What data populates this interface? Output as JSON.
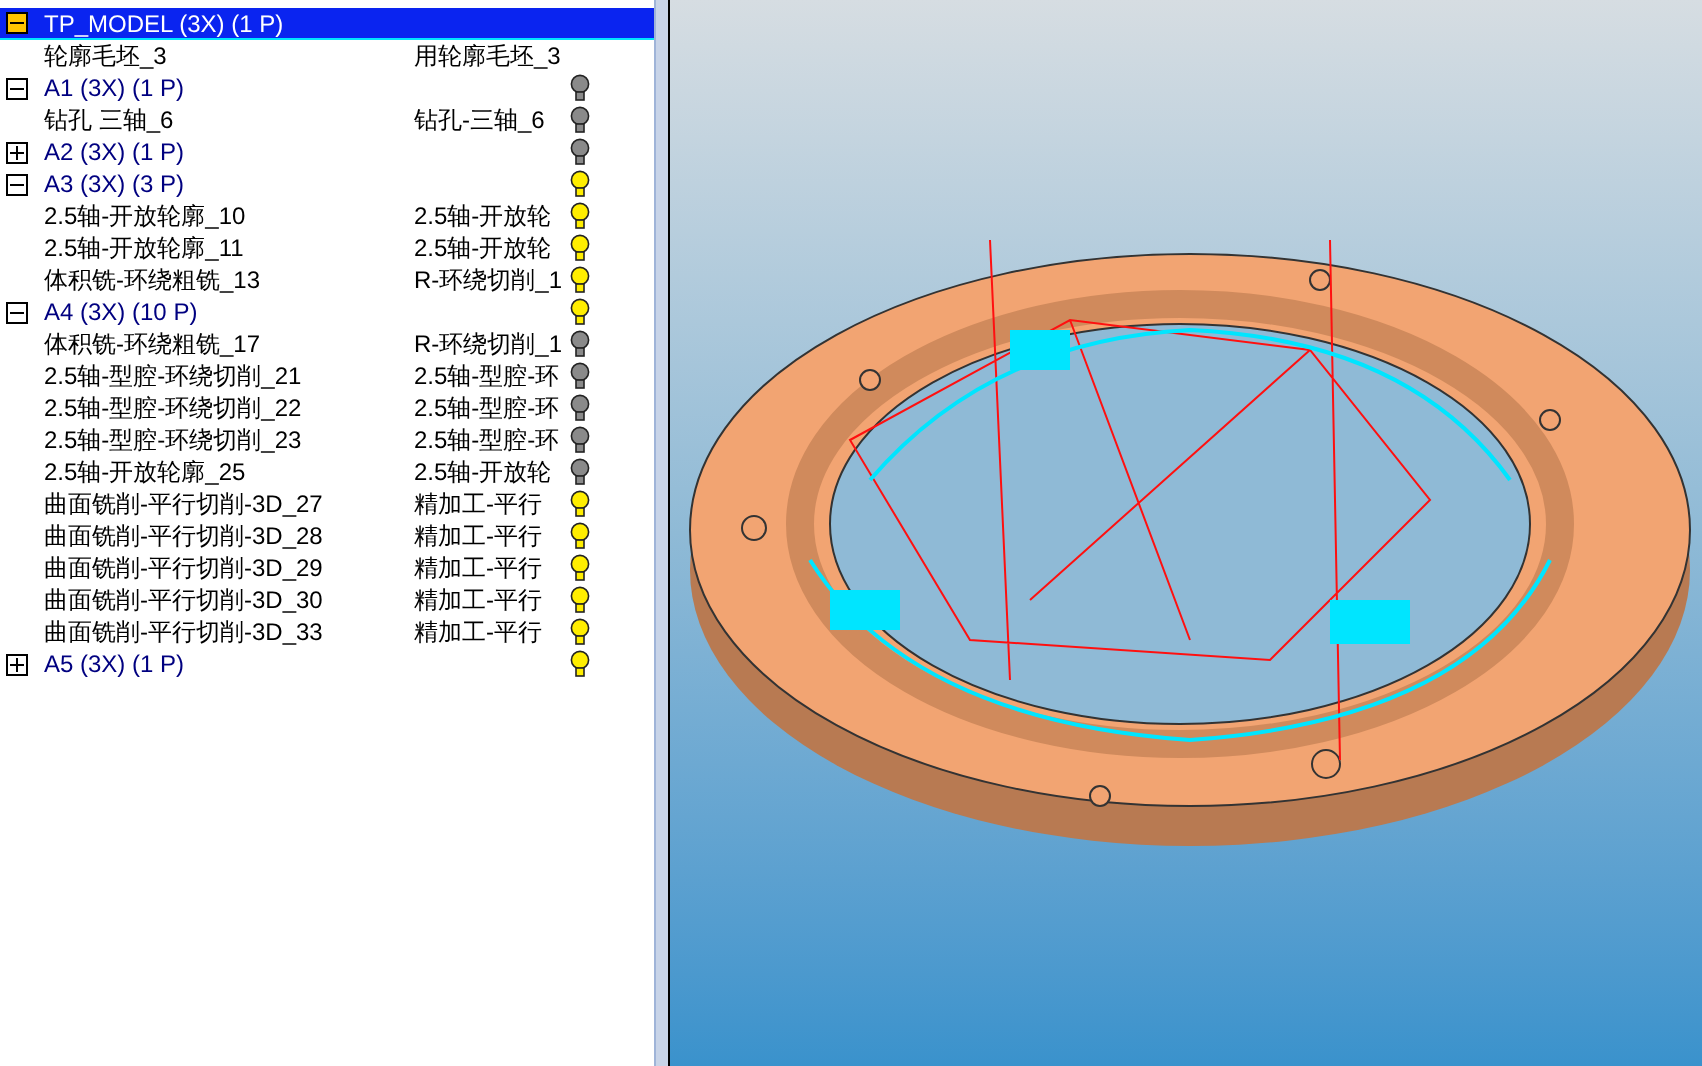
{
  "tree": [
    {
      "label": "TP_MODEL (3X) (1 P)",
      "expanded": true,
      "selected": true,
      "children": [
        {
          "name": "轮廓毛坯_3",
          "column_2": "用轮廓毛坯_3"
        }
      ]
    },
    {
      "label": "A1 (3X) (1 P)",
      "expanded": true,
      "selected": false,
      "lit": false,
      "children": [
        {
          "name": "钻孔 三轴_6",
          "column_2": "钻孔-三轴_6",
          "lit": false
        }
      ]
    },
    {
      "label": "A2 (3X) (1 P)",
      "expanded": false,
      "selected": false,
      "lit": false
    },
    {
      "label": "A3 (3X) (3 P)",
      "expanded": true,
      "selected": false,
      "lit": true,
      "children": [
        {
          "name": "2.5轴-开放轮廓_10",
          "column_2": "2.5轴-开放轮",
          "lit": true
        },
        {
          "name": "2.5轴-开放轮廓_11",
          "column_2": "2.5轴-开放轮",
          "lit": true
        },
        {
          "name": "体积铣-环绕粗铣_13",
          "column_2": "R-环绕切削_1",
          "lit": true
        }
      ]
    },
    {
      "label": "A4 (3X) (10 P)",
      "expanded": true,
      "selected": false,
      "lit": true,
      "children": [
        {
          "name": "体积铣-环绕粗铣_17",
          "column_2": "R-环绕切削_1",
          "lit": false
        },
        {
          "name": "2.5轴-型腔-环绕切削_21",
          "column_2": "2.5轴-型腔-环",
          "lit": false
        },
        {
          "name": "2.5轴-型腔-环绕切削_22",
          "column_2": "2.5轴-型腔-环",
          "lit": false
        },
        {
          "name": "2.5轴-型腔-环绕切削_23",
          "column_2": "2.5轴-型腔-环",
          "lit": false
        },
        {
          "name": "2.5轴-开放轮廓_25",
          "column_2": "2.5轴-开放轮",
          "lit": false
        },
        {
          "name": "曲面铣削-平行切削-3D_27",
          "column_2": "精加工-平行",
          "lit": true
        },
        {
          "name": "曲面铣削-平行切削-3D_28",
          "column_2": "精加工-平行",
          "lit": true
        },
        {
          "name": "曲面铣削-平行切削-3D_29",
          "column_2": "精加工-平行",
          "lit": true
        },
        {
          "name": "曲面铣削-平行切削-3D_30",
          "column_2": "精加工-平行",
          "lit": true
        },
        {
          "name": "曲面铣削-平行切削-3D_33",
          "column_2": "精加工-平行",
          "lit": true
        }
      ]
    },
    {
      "label": "A5 (3X) (1 P)",
      "expanded": false,
      "selected": false,
      "lit": true
    }
  ]
}
